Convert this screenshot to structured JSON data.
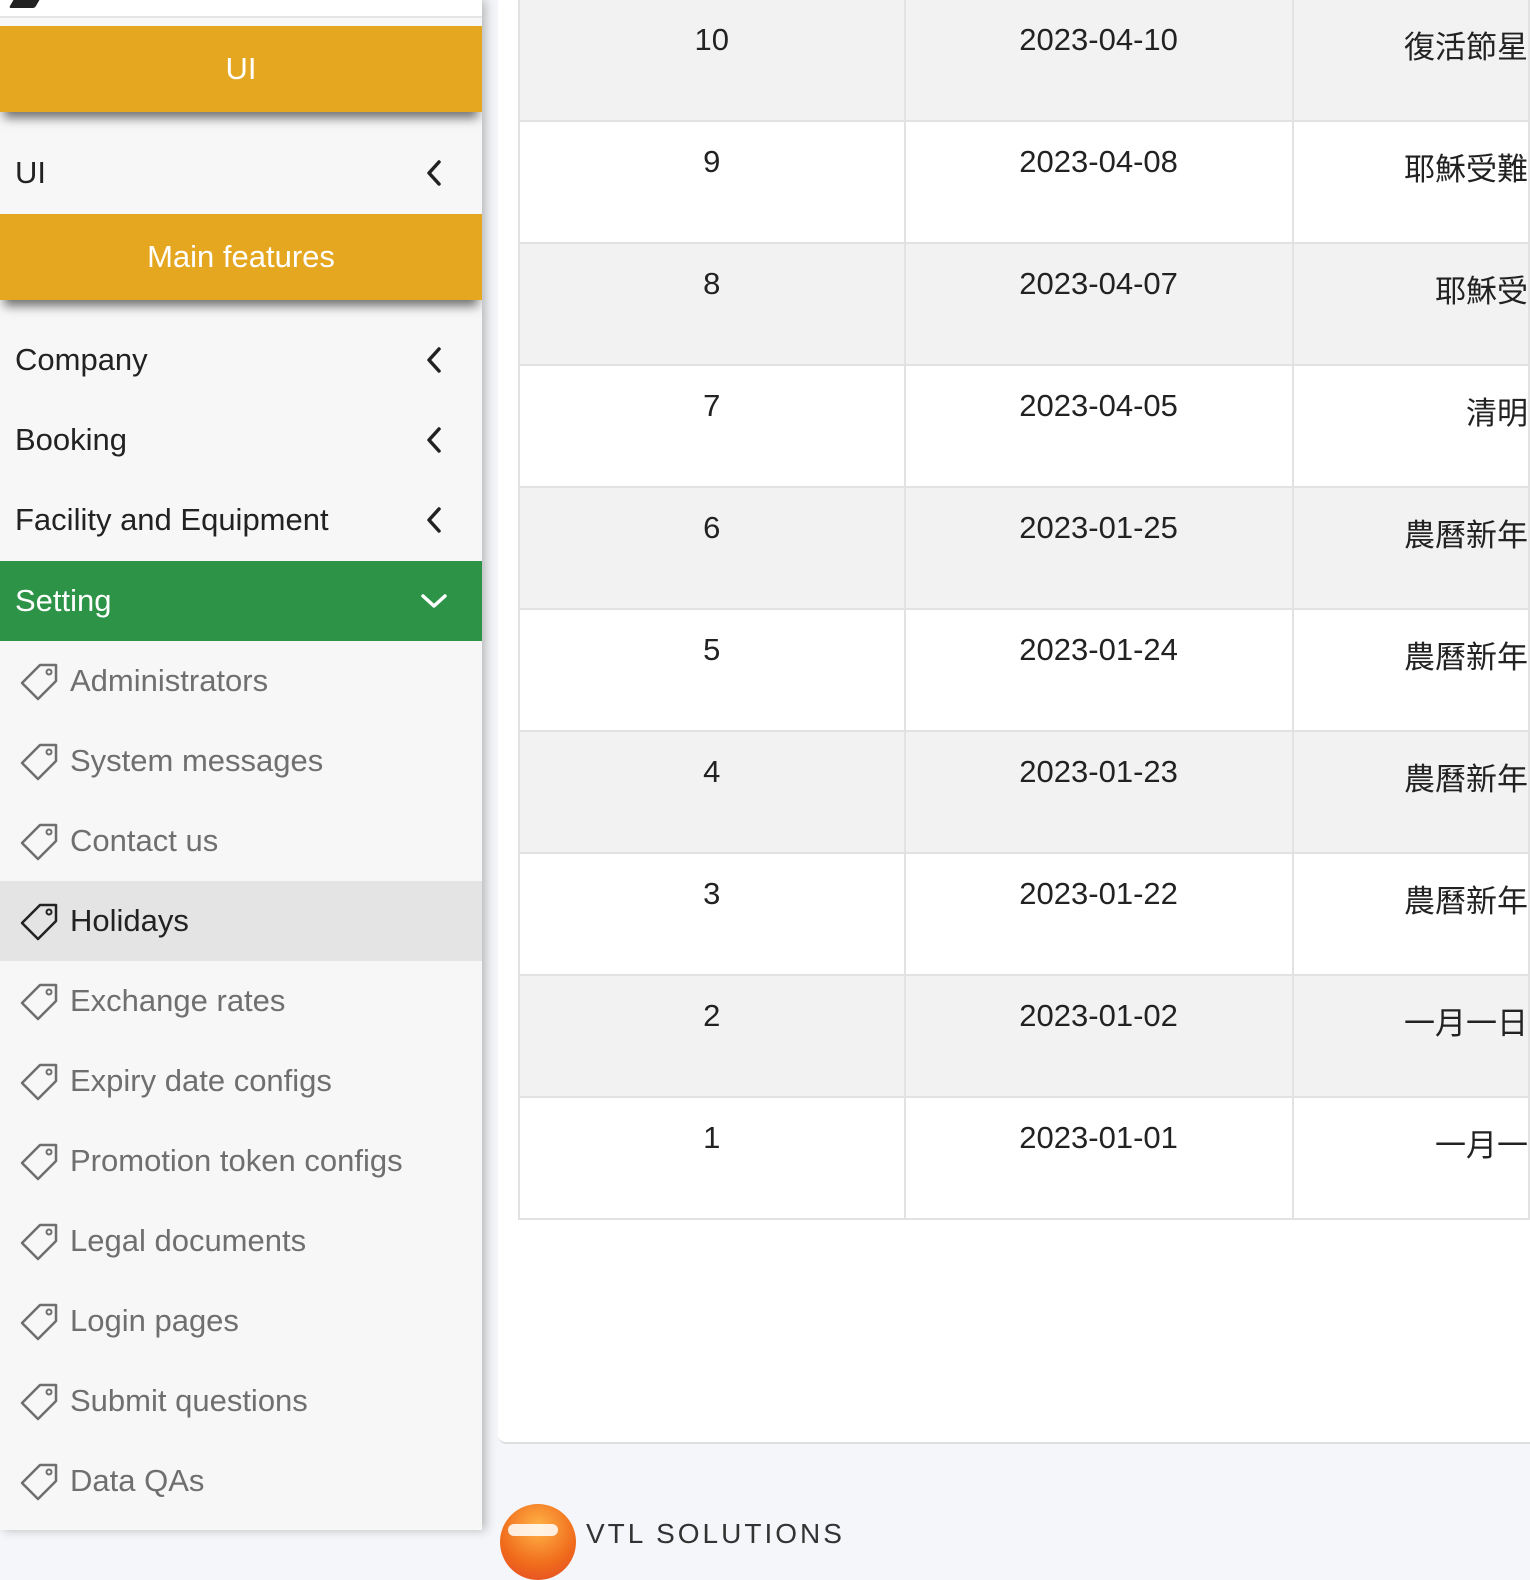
{
  "sidebar": {
    "header_ui": "UI",
    "ui_menu": "UI",
    "header_main": "Main features",
    "menus": [
      {
        "label": "Company"
      },
      {
        "label": "Booking"
      },
      {
        "label": "Facility and Equipment"
      }
    ],
    "active_menu": "Setting",
    "sub_items": [
      {
        "label": "Administrators"
      },
      {
        "label": "System messages"
      },
      {
        "label": "Contact us"
      },
      {
        "label": "Holidays"
      },
      {
        "label": "Exchange rates"
      },
      {
        "label": "Expiry date configs"
      },
      {
        "label": "Promotion token configs"
      },
      {
        "label": "Legal documents"
      },
      {
        "label": "Login pages"
      },
      {
        "label": "Submit questions"
      },
      {
        "label": "Data QAs"
      }
    ],
    "selected_sub_item": "Holidays"
  },
  "table": {
    "rows": [
      {
        "id": "10",
        "date": "2023-04-10",
        "name": "復活節星"
      },
      {
        "id": "9",
        "date": "2023-04-08",
        "name": "耶穌受難"
      },
      {
        "id": "8",
        "date": "2023-04-07",
        "name": "耶穌受"
      },
      {
        "id": "7",
        "date": "2023-04-05",
        "name": "清明"
      },
      {
        "id": "6",
        "date": "2023-01-25",
        "name": "農曆新年"
      },
      {
        "id": "5",
        "date": "2023-01-24",
        "name": "農曆新年"
      },
      {
        "id": "4",
        "date": "2023-01-23",
        "name": "農曆新年"
      },
      {
        "id": "3",
        "date": "2023-01-22",
        "name": "農曆新年"
      },
      {
        "id": "2",
        "date": "2023-01-02",
        "name": "一月一日"
      },
      {
        "id": "1",
        "date": "2023-01-01",
        "name": "一月一"
      }
    ]
  },
  "footer": {
    "brand": "VTL SOLUTIONS"
  },
  "colors": {
    "section_header": "#e5a620",
    "active_menu": "#2d9346",
    "selected_item": "#e4e4e4"
  }
}
